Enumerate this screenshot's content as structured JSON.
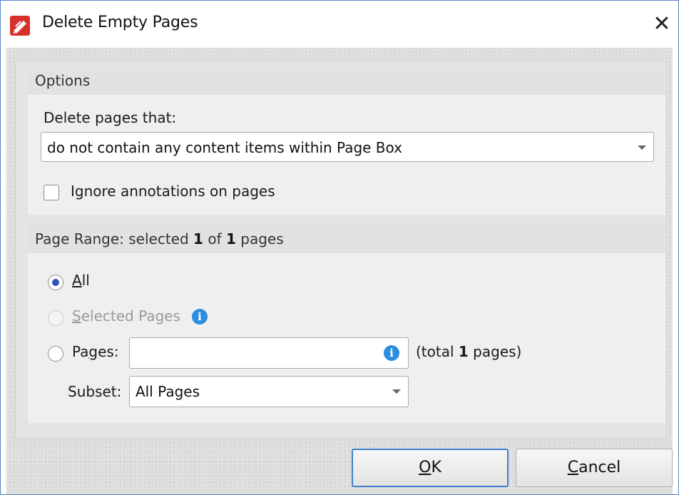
{
  "window": {
    "title": "Delete Empty Pages",
    "close_glyph": "✕",
    "app_icon": "pdf-editor-icon"
  },
  "options": {
    "group_title": "Options",
    "delete_label": "Delete pages that:",
    "delete_value": "do not contain any content items within Page Box",
    "ignore_annotations_label": "Ignore annotations on pages",
    "ignore_annotations_checked": false
  },
  "page_range": {
    "title_prefix": "Page Range: selected ",
    "selected": "1",
    "of_text": " of ",
    "total": "1",
    "pages_text": " pages",
    "all_label_u": "A",
    "all_label_rest": "ll",
    "selected_pages_label_u": "S",
    "selected_pages_label_rest": "elected Pages",
    "pages_label_pre": "Pa",
    "pages_label_u": "g",
    "pages_label_rest": "es:",
    "pages_input_value": "",
    "total_prefix": "(total ",
    "total_count": "1",
    "total_suffix": " pages)",
    "subset_label": "Subset:",
    "subset_value": "All Pages",
    "selected_option": "All"
  },
  "buttons": {
    "ok_u": "O",
    "ok_rest": "K",
    "cancel_u": "C",
    "cancel_rest": "ancel"
  },
  "colors": {
    "accent": "#2a56b8",
    "info": "#2d8de0",
    "frame_border": "#5a86c8"
  }
}
